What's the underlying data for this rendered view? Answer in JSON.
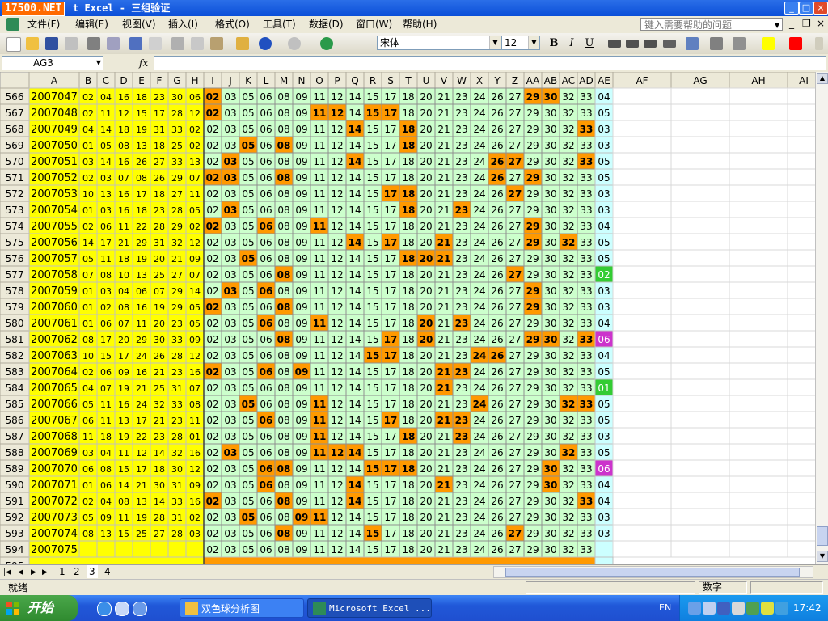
{
  "title_bar": {
    "logo": "17500.NET",
    "title": "t Excel - 三组验证"
  },
  "menu": {
    "items": [
      "文件(F)",
      "编辑(E)",
      "视图(V)",
      "插入(I)",
      "格式(O)",
      "工具(T)",
      "数据(D)",
      "窗口(W)",
      "帮助(H)"
    ],
    "help_placeholder": "键入需要帮助的问题"
  },
  "toolbar": {
    "font_name": "宋体",
    "font_size": "12",
    "bold": "B",
    "italic": "I",
    "underline": "U"
  },
  "formula_bar": {
    "name_box": "AG3",
    "fx": "fx",
    "formula": ""
  },
  "columns": [
    "A",
    "B",
    "C",
    "D",
    "E",
    "F",
    "G",
    "H",
    "I",
    "J",
    "K",
    "L",
    "M",
    "N",
    "O",
    "P",
    "Q",
    "R",
    "S",
    "T",
    "U",
    "V",
    "W",
    "X",
    "Y",
    "Z",
    "AA",
    "AB",
    "AC",
    "AD",
    "AE",
    "AF",
    "AG",
    "AH",
    "AI"
  ],
  "pool": [
    "02",
    "03",
    "05",
    "06",
    "08",
    "09",
    "11",
    "12",
    "14",
    "15",
    "17",
    "18",
    "20",
    "21",
    "23",
    "24",
    "26",
    "27",
    "29",
    "30",
    "32",
    "33"
  ],
  "rows": [
    {
      "n": 566,
      "issue": "2007047",
      "draw": [
        "02",
        "04",
        "16",
        "18",
        "23",
        "30",
        "06"
      ],
      "hits": [
        0,
        18,
        19
      ],
      "ae": "04"
    },
    {
      "n": 567,
      "issue": "2007048",
      "draw": [
        "02",
        "11",
        "12",
        "15",
        "17",
        "28",
        "12"
      ],
      "hits": [
        0,
        6,
        7,
        9,
        10
      ],
      "ae": "05"
    },
    {
      "n": 568,
      "issue": "2007049",
      "draw": [
        "04",
        "14",
        "18",
        "19",
        "31",
        "33",
        "02"
      ],
      "hits": [
        8,
        11,
        21
      ],
      "ae": "03"
    },
    {
      "n": 569,
      "issue": "2007050",
      "draw": [
        "01",
        "05",
        "08",
        "13",
        "18",
        "25",
        "02"
      ],
      "hits": [
        2,
        4,
        11
      ],
      "ae": "03"
    },
    {
      "n": 570,
      "issue": "2007051",
      "draw": [
        "03",
        "14",
        "16",
        "26",
        "27",
        "33",
        "13"
      ],
      "hits": [
        1,
        8,
        16,
        17,
        21
      ],
      "ae": "05"
    },
    {
      "n": 571,
      "issue": "2007052",
      "draw": [
        "02",
        "03",
        "07",
        "08",
        "26",
        "29",
        "07"
      ],
      "hits": [
        0,
        1,
        4,
        16,
        18
      ],
      "ae": "05"
    },
    {
      "n": 572,
      "issue": "2007053",
      "draw": [
        "10",
        "13",
        "16",
        "17",
        "18",
        "27",
        "11"
      ],
      "hits": [
        10,
        11,
        17
      ],
      "ae": "03"
    },
    {
      "n": 573,
      "issue": "2007054",
      "draw": [
        "01",
        "03",
        "16",
        "18",
        "23",
        "28",
        "05"
      ],
      "hits": [
        1,
        11,
        14
      ],
      "ae": "03"
    },
    {
      "n": 574,
      "issue": "2007055",
      "draw": [
        "02",
        "06",
        "11",
        "22",
        "28",
        "29",
        "02"
      ],
      "hits": [
        0,
        3,
        6,
        18
      ],
      "ae": "04"
    },
    {
      "n": 575,
      "issue": "2007056",
      "draw": [
        "14",
        "17",
        "21",
        "29",
        "31",
        "32",
        "12"
      ],
      "hits": [
        8,
        10,
        13,
        18,
        20
      ],
      "ae": "05"
    },
    {
      "n": 576,
      "issue": "2007057",
      "draw": [
        "05",
        "11",
        "18",
        "19",
        "20",
        "21",
        "09"
      ],
      "hits": [
        2,
        11,
        12,
        13
      ],
      "ae": "05"
    },
    {
      "n": 577,
      "issue": "2007058",
      "draw": [
        "07",
        "08",
        "10",
        "13",
        "25",
        "27",
        "07"
      ],
      "hits": [
        4,
        17
      ],
      "ae": "02"
    },
    {
      "n": 578,
      "issue": "2007059",
      "draw": [
        "01",
        "03",
        "04",
        "06",
        "07",
        "29",
        "14"
      ],
      "hits": [
        1,
        3,
        18
      ],
      "ae": "03"
    },
    {
      "n": 579,
      "issue": "2007060",
      "draw": [
        "01",
        "02",
        "08",
        "16",
        "19",
        "29",
        "05"
      ],
      "hits": [
        0,
        4,
        18
      ],
      "ae": "03"
    },
    {
      "n": 580,
      "issue": "2007061",
      "draw": [
        "01",
        "06",
        "07",
        "11",
        "20",
        "23",
        "05"
      ],
      "hits": [
        3,
        6,
        12,
        14
      ],
      "ae": "04"
    },
    {
      "n": 581,
      "issue": "2007062",
      "draw": [
        "08",
        "17",
        "20",
        "29",
        "30",
        "33",
        "09"
      ],
      "hits": [
        4,
        10,
        12,
        18,
        19,
        21
      ],
      "ae": "06"
    },
    {
      "n": 582,
      "issue": "2007063",
      "draw": [
        "10",
        "15",
        "17",
        "24",
        "26",
        "28",
        "12"
      ],
      "hits": [
        9,
        10,
        15,
        16
      ],
      "ae": "04"
    },
    {
      "n": 583,
      "issue": "2007064",
      "draw": [
        "02",
        "06",
        "09",
        "16",
        "21",
        "23",
        "16"
      ],
      "hits": [
        0,
        3,
        5,
        13,
        14
      ],
      "ae": "05"
    },
    {
      "n": 584,
      "issue": "2007065",
      "draw": [
        "04",
        "07",
        "19",
        "21",
        "25",
        "31",
        "07"
      ],
      "hits": [
        13
      ],
      "ae": "01"
    },
    {
      "n": 585,
      "issue": "2007066",
      "draw": [
        "05",
        "11",
        "16",
        "24",
        "32",
        "33",
        "08"
      ],
      "hits": [
        2,
        6,
        15,
        20,
        21
      ],
      "ae": "05"
    },
    {
      "n": 586,
      "issue": "2007067",
      "draw": [
        "06",
        "11",
        "13",
        "17",
        "21",
        "23",
        "11"
      ],
      "hits": [
        3,
        6,
        10,
        13,
        14
      ],
      "ae": "05"
    },
    {
      "n": 587,
      "issue": "2007068",
      "draw": [
        "11",
        "18",
        "19",
        "22",
        "23",
        "28",
        "01"
      ],
      "hits": [
        6,
        11,
        14
      ],
      "ae": "03"
    },
    {
      "n": 588,
      "issue": "2007069",
      "draw": [
        "03",
        "04",
        "11",
        "12",
        "14",
        "32",
        "16"
      ],
      "hits": [
        1,
        6,
        7,
        8,
        20
      ],
      "ae": "05"
    },
    {
      "n": 589,
      "issue": "2007070",
      "draw": [
        "06",
        "08",
        "15",
        "17",
        "18",
        "30",
        "12"
      ],
      "hits": [
        3,
        4,
        9,
        10,
        11,
        19
      ],
      "ae": "06"
    },
    {
      "n": 590,
      "issue": "2007071",
      "draw": [
        "01",
        "06",
        "14",
        "21",
        "30",
        "31",
        "09"
      ],
      "hits": [
        3,
        8,
        13,
        19
      ],
      "ae": "04"
    },
    {
      "n": 591,
      "issue": "2007072",
      "draw": [
        "02",
        "04",
        "08",
        "13",
        "14",
        "33",
        "16"
      ],
      "hits": [
        0,
        4,
        8,
        21
      ],
      "ae": "04"
    },
    {
      "n": 592,
      "issue": "2007073",
      "draw": [
        "05",
        "09",
        "11",
        "19",
        "28",
        "31",
        "02"
      ],
      "hits": [
        2,
        5,
        6
      ],
      "ae": "03"
    },
    {
      "n": 593,
      "issue": "2007074",
      "draw": [
        "08",
        "13",
        "15",
        "25",
        "27",
        "28",
        "03"
      ],
      "hits": [
        4,
        9,
        17
      ],
      "ae": "03"
    },
    {
      "n": 594,
      "issue": "2007075",
      "draw": [
        "",
        "",
        "",
        "",
        "",
        "",
        ""
      ],
      "hits": [],
      "ae": ""
    }
  ],
  "partial_row": "595",
  "sheet_tabs": [
    "1",
    "2",
    "3",
    "4"
  ],
  "active_tab": 2,
  "status": {
    "left": "就绪",
    "mode": "数字"
  },
  "taskbar": {
    "start": "开始",
    "tasks": [
      "双色球分析图",
      "Microsoft Excel ..."
    ],
    "lang": "EN",
    "clock": "17:42"
  },
  "colors": {
    "draw_bg": "#ffff00",
    "pool_bg": "#ccffcc",
    "hit_bg": "#ff9900",
    "ae_bg": "#ccffff",
    "ae_highlight_02": "#33cc33",
    "ae_highlight_06": "#cc33cc",
    "ae_highlight_01": "#33cc33"
  }
}
